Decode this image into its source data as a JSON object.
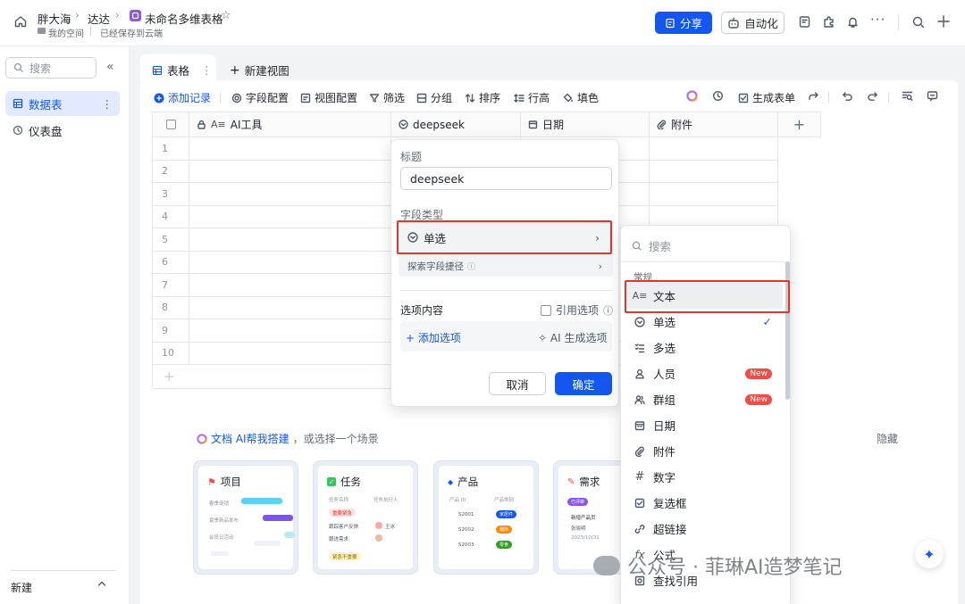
{
  "breadcrumb": {
    "root": "胖大海",
    "mid": "达达",
    "current": "未命名多维表格",
    "space": "我的空间",
    "saved": "已经保存到云端"
  },
  "header": {
    "share_label": "分享",
    "automation_label": "自动化"
  },
  "sidebar": {
    "search_placeholder": "搜索",
    "items": [
      {
        "label": "数据表"
      },
      {
        "label": "仪表盘"
      }
    ],
    "new_label": "新建"
  },
  "tabs": {
    "table_label": "表格",
    "new_view_label": "新建视图"
  },
  "toolbar": {
    "add_record": "添加记录",
    "field_config": "字段配置",
    "view_config": "视图配置",
    "filter": "筛选",
    "group": "分组",
    "sort": "排序",
    "row_height": "行高",
    "fill": "填色",
    "gen_form": "生成表单"
  },
  "grid": {
    "columns": [
      {
        "label": "AI工具"
      },
      {
        "label": "deepseek"
      },
      {
        "label": "日期"
      },
      {
        "label": "附件"
      }
    ],
    "rows": [
      "1",
      "2",
      "3",
      "4",
      "5",
      "6",
      "7",
      "8",
      "9",
      "10"
    ]
  },
  "field_popup": {
    "title_label": "标题",
    "title_value": "deepseek",
    "type_label": "字段类型",
    "type_value": "单选",
    "explore_label": "探索字段捷径",
    "options_label": "选项内容",
    "ref_options_label": "引用选项",
    "add_option_label": "添加选项",
    "ai_gen_label": "AI 生成选项",
    "cancel_label": "取消",
    "confirm_label": "确定"
  },
  "type_menu": {
    "search_placeholder": "搜索",
    "section_label": "常规",
    "items": [
      {
        "label": "文本",
        "icon": "text-icon"
      },
      {
        "label": "单选",
        "icon": "single-select-icon"
      },
      {
        "label": "多选",
        "icon": "multi-select-icon"
      },
      {
        "label": "人员",
        "icon": "person-icon",
        "badge": "New"
      },
      {
        "label": "群组",
        "icon": "group-icon",
        "badge": "New"
      },
      {
        "label": "日期",
        "icon": "date-icon"
      },
      {
        "label": "附件",
        "icon": "attachment-icon"
      },
      {
        "label": "数字",
        "icon": "number-icon"
      },
      {
        "label": "复选框",
        "icon": "checkbox-icon"
      },
      {
        "label": "超链接",
        "icon": "link-icon"
      },
      {
        "label": "公式",
        "icon": "formula-icon"
      },
      {
        "label": "查找引用",
        "icon": "lookup-icon"
      }
    ]
  },
  "ai_hint": {
    "link_text": "文档 AI帮我搭建",
    "rest_text": "，或选择一个场景",
    "hide_label": "隐藏"
  },
  "templates": [
    {
      "title": "项目",
      "rows": [
        "春季促销",
        "夏季新品发布",
        "会员日活动"
      ]
    },
    {
      "title": "任务",
      "cols": [
        "任务名称",
        "任务执行人"
      ],
      "group": "重要紧急",
      "rows": [
        "跟踪客户反馈",
        "跟进需求"
      ],
      "people": [
        "王冰"
      ],
      "group2": "紧急不重要"
    },
    {
      "title": "产品",
      "cols": [
        "产品 ID",
        "产品类别"
      ],
      "rows": [
        "S2001",
        "S2002",
        "S2003"
      ],
      "tags": [
        "家居件",
        "服饰",
        "零食"
      ]
    },
    {
      "title": "需求",
      "tag": "已评审",
      "line1": "新增产品页",
      "line2": "张晓明",
      "line3": "2023/10/31"
    }
  ],
  "watermark": "公众号 · 菲琳AI造梦笔记"
}
